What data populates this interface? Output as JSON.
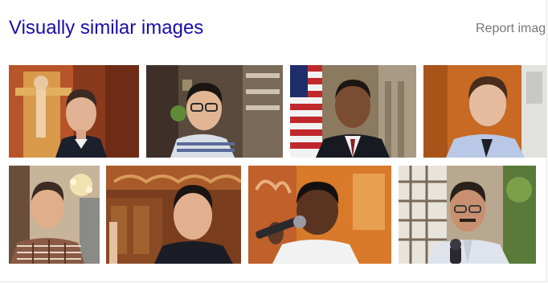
{
  "header": {
    "title": "Visually similar images",
    "report_label": "Report imag"
  },
  "colors": {
    "link_blue": "#1a0dab",
    "report_gray": "#777777"
  },
  "images": [
    {
      "row": 1,
      "subject": "man in suit, religious painting background"
    },
    {
      "row": 1,
      "subject": "man with glasses, striped polo shirt"
    },
    {
      "row": 1,
      "subject": "man in suit with flag background"
    },
    {
      "row": 1,
      "subject": "man in blue shirt and tie"
    },
    {
      "row": 2,
      "subject": "man in plaid shirt, chandelier background"
    },
    {
      "row": 2,
      "subject": "man in suit, wooden carved background"
    },
    {
      "row": 2,
      "subject": "man speaking into microphone"
    },
    {
      "row": 2,
      "subject": "man with glasses and mustache, window background"
    }
  ]
}
